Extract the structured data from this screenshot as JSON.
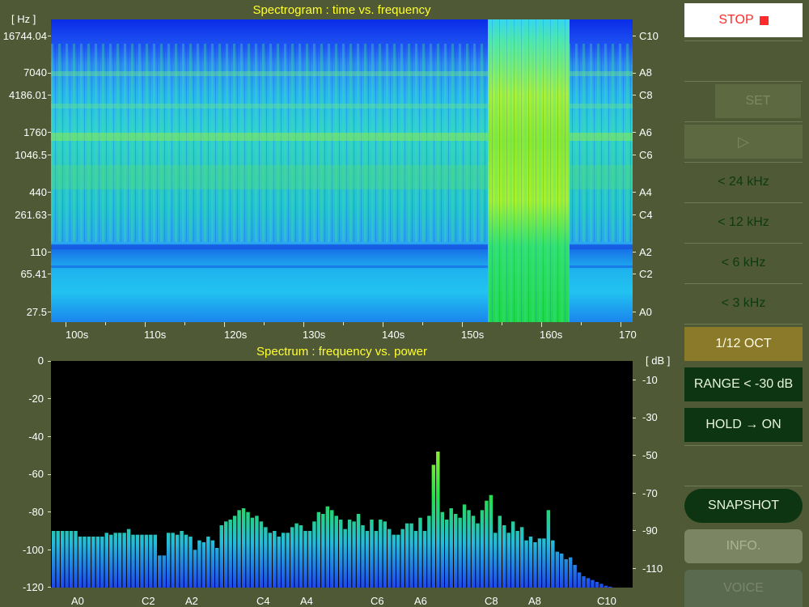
{
  "spectrogram": {
    "title": "Spectrogram : time vs. frequency",
    "y_unit": "[ Hz ]",
    "freq_labels": [
      "16744.04",
      "7040",
      "4186.01",
      "1760",
      "1046.5",
      "440",
      "261.63",
      "110",
      "65.41",
      "27.5"
    ],
    "note_labels": [
      "C10",
      "A8",
      "C8",
      "A6",
      "C6",
      "A4",
      "C4",
      "A2",
      "C2",
      "A0"
    ],
    "time_labels": [
      "100s",
      "110s",
      "120s",
      "130s",
      "140s",
      "150s",
      "160s",
      "170"
    ]
  },
  "spectrum": {
    "title": "Spectrum : frequency vs. power",
    "y_unit": "[ dB ]",
    "left_labels": [
      "0",
      "-20",
      "-40",
      "-60",
      "-80",
      "-100",
      "-120"
    ],
    "right_labels": [
      "-10",
      "-30",
      "-50",
      "-70",
      "-90",
      "-110"
    ],
    "note_labels": [
      "A0",
      "C2",
      "A2",
      "C4",
      "A4",
      "C6",
      "A6",
      "C8",
      "A8",
      "C10"
    ]
  },
  "controls": {
    "stop": "STOP",
    "set": "SET",
    "play": "▷",
    "r24": "< 24 kHz",
    "r12": "< 12 kHz",
    "r6": "< 6 kHz",
    "r3": "< 3 kHz",
    "oct": "1/12 OCT",
    "range": "RANGE < -30 dB",
    "hold": "HOLD → ON",
    "snapshot": "SNAPSHOT",
    "info": "INFO.",
    "voice": "VOICE"
  },
  "colors": {
    "panel_bg": "#4f5936",
    "title": "#ffff33",
    "stop_text": "#ff2a2a",
    "dark_button": "#0e3512",
    "amber_button": "#8a7a2a"
  },
  "chart_data": {
    "type": "bar",
    "title": "Spectrum : frequency vs. power",
    "ylabel": "[ dB ]",
    "ylim": [
      -120,
      0
    ],
    "x_tick_labels": [
      "A0",
      "C2",
      "A2",
      "C4",
      "A4",
      "C6",
      "A6",
      "C8",
      "A8",
      "C10"
    ],
    "values": [
      -90,
      -90,
      -90,
      -90,
      -90,
      -90,
      -93,
      -93,
      -93,
      -93,
      -93,
      -93,
      -91,
      -92,
      -91,
      -91,
      -91,
      -89,
      -92,
      -92,
      -92,
      -92,
      -92,
      -92,
      -103,
      -103,
      -91,
      -91,
      -92,
      -90,
      -92,
      -93,
      -100,
      -95,
      -96,
      -93,
      -95,
      -99,
      -87,
      -85,
      -84,
      -82,
      -79,
      -78,
      -80,
      -83,
      -82,
      -85,
      -88,
      -91,
      -90,
      -93,
      -91,
      -91,
      -88,
      -86,
      -87,
      -90,
      -90,
      -85,
      -80,
      -81,
      -77,
      -79,
      -82,
      -84,
      -89,
      -84,
      -85,
      -81,
      -87,
      -90,
      -84,
      -90,
      -84,
      -85,
      -89,
      -92,
      -92,
      -89,
      -86,
      -86,
      -90,
      -83,
      -90,
      -82,
      -55,
      -48,
      -80,
      -84,
      -78,
      -81,
      -83,
      -76,
      -79,
      -82,
      -86,
      -79,
      -74,
      -71,
      -91,
      -82,
      -87,
      -91,
      -85,
      -90,
      -88,
      -95,
      -93,
      -96,
      -94,
      -94,
      -79,
      -95,
      -101,
      -102,
      -105,
      -104,
      -108,
      -112,
      -114,
      -115,
      -116,
      -117,
      -118,
      -119,
      -119.5,
      -120
    ],
    "grid": false
  }
}
